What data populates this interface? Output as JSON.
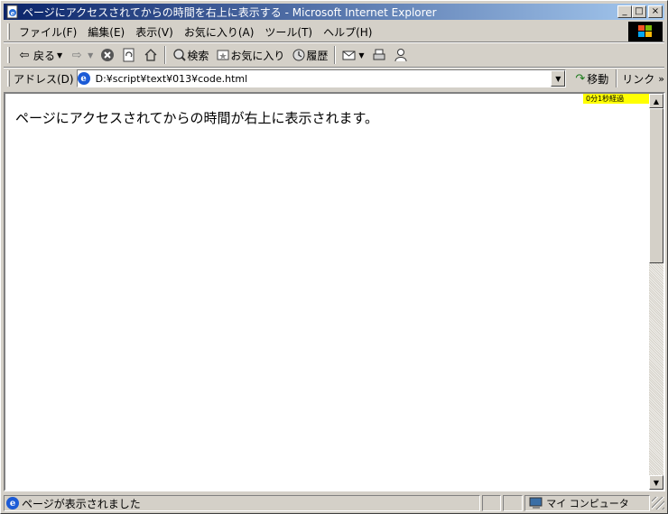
{
  "window": {
    "title": "ページにアクセスされてからの時間を右上に表示する - Microsoft Internet Explorer",
    "buttons": {
      "minimize": "_",
      "maximize": "□",
      "close": "×"
    }
  },
  "menu": {
    "items": [
      "ファイル(F)",
      "編集(E)",
      "表示(V)",
      "お気に入り(A)",
      "ツール(T)",
      "ヘルプ(H)"
    ]
  },
  "toolbar": {
    "back_label": "戻る",
    "search_label": "検索",
    "favorites_label": "お気に入り",
    "history_label": "履歴"
  },
  "address": {
    "label": "アドレス(D)",
    "url": "D:¥script¥text¥013¥code.html",
    "go_label": "移動",
    "links_label": "リンク"
  },
  "page": {
    "body_text": "ページにアクセスされてからの時間が右上に表示されます。",
    "timer_text": "0分1秒経過"
  },
  "status": {
    "text": "ページが表示されました",
    "zone": "マイ コンピュータ"
  },
  "colors": {
    "titlebar_start": "#0a246a",
    "titlebar_end": "#a6caf0",
    "timer_bg": "#ffff00"
  }
}
